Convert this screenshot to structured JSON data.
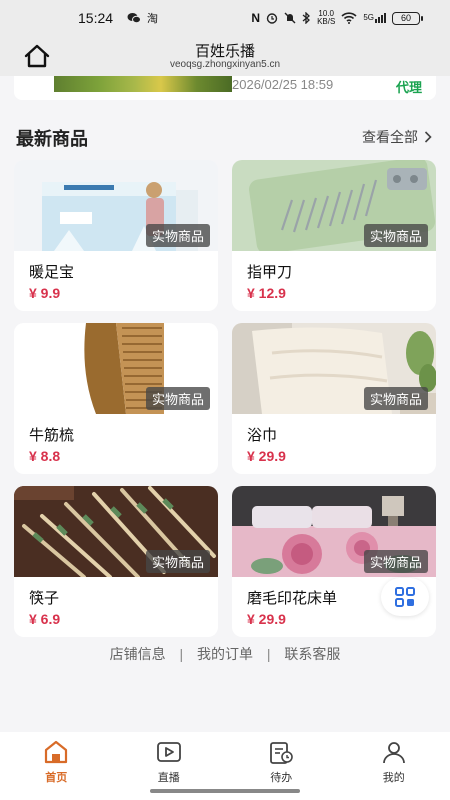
{
  "status_bar": {
    "time": "15:24",
    "network_speed": "10.0",
    "speed_unit": "KB/S",
    "signal": "5G",
    "battery": "60"
  },
  "header": {
    "title": "百姓乐播",
    "url": "veoqsg.zhongxinyan5.cn"
  },
  "top_card": {
    "date": "2026/02/25 18:59",
    "badge": "代理"
  },
  "section": {
    "title": "最新商品",
    "view_all": "查看全部"
  },
  "products": [
    {
      "name": "暖足宝",
      "price": "¥ 9.9",
      "tag": "实物商品"
    },
    {
      "name": "指甲刀",
      "price": "¥ 12.9",
      "tag": "实物商品"
    },
    {
      "name": "牛筋梳",
      "price": "¥ 8.8",
      "tag": "实物商品"
    },
    {
      "name": "浴巾",
      "price": "¥ 29.9",
      "tag": "实物商品"
    },
    {
      "name": "筷子",
      "price": "¥ 6.9",
      "tag": "实物商品"
    },
    {
      "name": "磨毛印花床单",
      "price": "¥ 29.9",
      "tag": "实物商品"
    }
  ],
  "footer_links": [
    "店铺信息",
    "我的订单",
    "联系客服"
  ],
  "bottom_nav": [
    {
      "label": "首页",
      "icon": "home-icon",
      "active": true
    },
    {
      "label": "直播",
      "icon": "play-icon",
      "active": false
    },
    {
      "label": "待办",
      "icon": "todo-icon",
      "active": false
    },
    {
      "label": "我的",
      "icon": "user-icon",
      "active": false
    }
  ],
  "colors": {
    "accent": "#d86b28",
    "price": "#d8324c",
    "badge": "#1aa350"
  }
}
